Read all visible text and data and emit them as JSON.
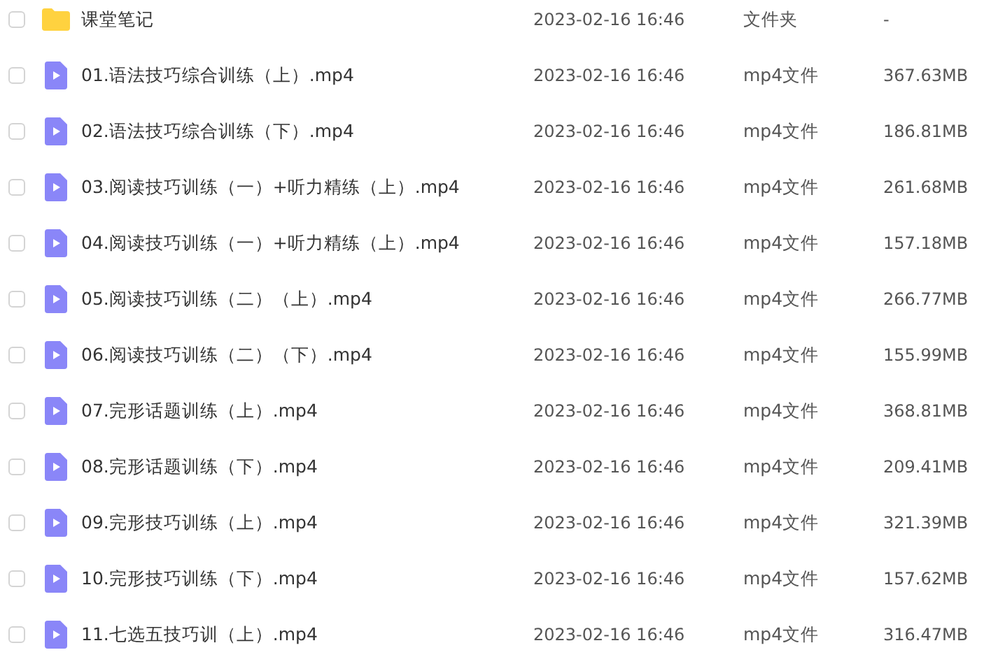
{
  "files": [
    {
      "kind": "folder",
      "checked": false,
      "name": "课堂笔记",
      "modified": "2023-02-16 16:46",
      "type": "文件夹",
      "size": "-"
    },
    {
      "kind": "video",
      "checked": false,
      "name": "01.语法技巧综合训练（上）.mp4",
      "modified": "2023-02-16 16:46",
      "type": "mp4文件",
      "size": "367.63MB"
    },
    {
      "kind": "video",
      "checked": false,
      "name": "02.语法技巧综合训练（下）.mp4",
      "modified": "2023-02-16 16:46",
      "type": "mp4文件",
      "size": "186.81MB"
    },
    {
      "kind": "video",
      "checked": false,
      "name": "03.阅读技巧训练（一）+听力精练（上）.mp4",
      "modified": "2023-02-16 16:46",
      "type": "mp4文件",
      "size": "261.68MB"
    },
    {
      "kind": "video",
      "checked": false,
      "name": "04.阅读技巧训练（一）+听力精练（上）.mp4",
      "modified": "2023-02-16 16:46",
      "type": "mp4文件",
      "size": "157.18MB"
    },
    {
      "kind": "video",
      "checked": false,
      "name": "05.阅读技巧训练（二）（上）.mp4",
      "modified": "2023-02-16 16:46",
      "type": "mp4文件",
      "size": "266.77MB"
    },
    {
      "kind": "video",
      "checked": false,
      "name": "06.阅读技巧训练（二）（下）.mp4",
      "modified": "2023-02-16 16:46",
      "type": "mp4文件",
      "size": "155.99MB"
    },
    {
      "kind": "video",
      "checked": false,
      "name": "07.完形话题训练（上）.mp4",
      "modified": "2023-02-16 16:46",
      "type": "mp4文件",
      "size": "368.81MB"
    },
    {
      "kind": "video",
      "checked": false,
      "name": "08.完形话题训练（下）.mp4",
      "modified": "2023-02-16 16:46",
      "type": "mp4文件",
      "size": "209.41MB"
    },
    {
      "kind": "video",
      "checked": false,
      "name": "09.完形技巧训练（上）.mp4",
      "modified": "2023-02-16 16:46",
      "type": "mp4文件",
      "size": "321.39MB"
    },
    {
      "kind": "video",
      "checked": false,
      "name": "10.完形技巧训练（下）.mp4",
      "modified": "2023-02-16 16:46",
      "type": "mp4文件",
      "size": "157.62MB"
    },
    {
      "kind": "video",
      "checked": false,
      "name": "11.七选五技巧训（上）.mp4",
      "modified": "2023-02-16 16:46",
      "type": "mp4文件",
      "size": "316.47MB"
    }
  ]
}
